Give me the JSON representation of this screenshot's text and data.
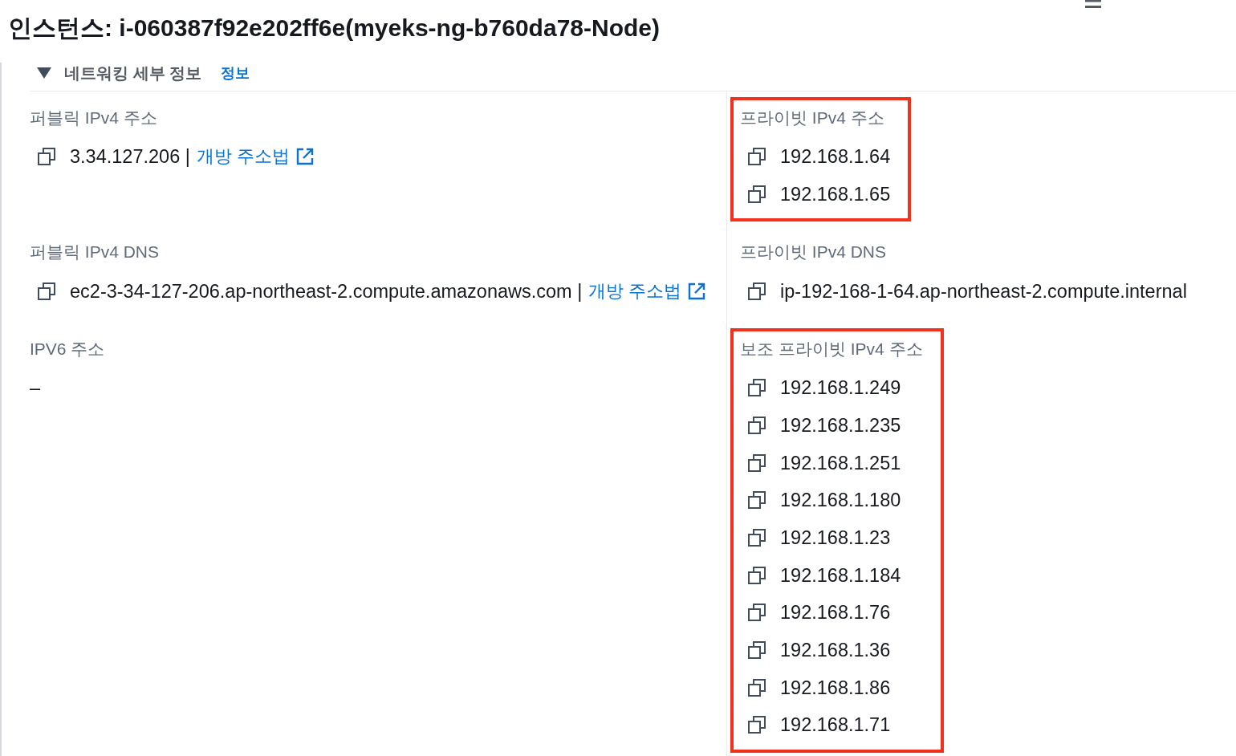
{
  "header": {
    "title": "인스턴스: i-060387f92e202ff6e(myeks-ng-b760da78-Node)"
  },
  "section": {
    "title": "네트워킹 세부 정보",
    "info_link": "정보",
    "expanded": true
  },
  "rows": [
    {
      "left": {
        "label": "퍼블릭 IPv4 주소",
        "highlighted": false,
        "values": [
          {
            "text": "3.34.127.206",
            "copyable": true,
            "separator": "|",
            "link": "개방 주소법"
          }
        ]
      },
      "right": {
        "label": "프라이빗 IPv4 주소",
        "highlighted": true,
        "values": [
          {
            "text": "192.168.1.64",
            "copyable": true
          },
          {
            "text": "192.168.1.65",
            "copyable": true
          }
        ]
      }
    },
    {
      "left": {
        "label": "퍼블릭 IPv4 DNS",
        "highlighted": false,
        "values": [
          {
            "text": "ec2-3-34-127-206.ap-northeast-2.compute.amazonaws.com",
            "copyable": true,
            "separator": "|",
            "link": "개방 주소법"
          }
        ]
      },
      "right": {
        "label": "프라이빗 IPv4 DNS",
        "highlighted": false,
        "values": [
          {
            "text": "ip-192-168-1-64.ap-northeast-2.compute.internal",
            "copyable": true
          }
        ]
      }
    },
    {
      "left": {
        "label": "IPV6 주소",
        "highlighted": false,
        "values": [
          {
            "text": "–",
            "copyable": false
          }
        ]
      },
      "right": {
        "label": "보조 프라이빗 IPv4 주소",
        "highlighted": true,
        "values": [
          {
            "text": "192.168.1.249",
            "copyable": true
          },
          {
            "text": "192.168.1.235",
            "copyable": true
          },
          {
            "text": "192.168.1.251",
            "copyable": true
          },
          {
            "text": "192.168.1.180",
            "copyable": true
          },
          {
            "text": "192.168.1.23",
            "copyable": true
          },
          {
            "text": "192.168.1.184",
            "copyable": true
          },
          {
            "text": "192.168.1.76",
            "copyable": true
          },
          {
            "text": "192.168.1.36",
            "copyable": true
          },
          {
            "text": "192.168.1.86",
            "copyable": true
          },
          {
            "text": "192.168.1.71",
            "copyable": true
          }
        ]
      }
    }
  ]
}
